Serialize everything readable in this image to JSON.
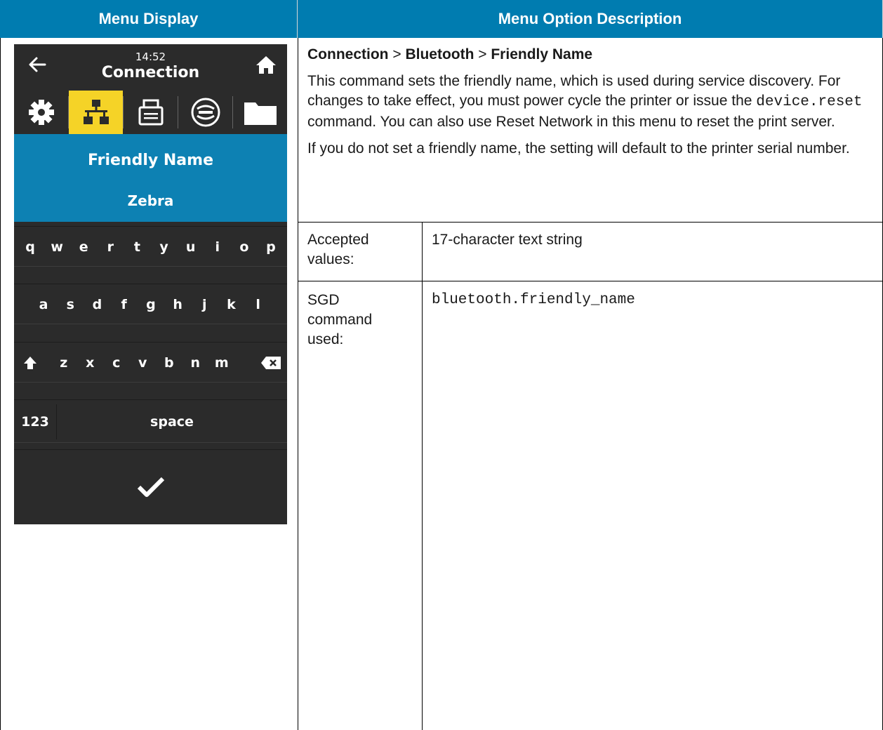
{
  "table": {
    "header_left": "Menu Display",
    "header_right": "Menu Option Description"
  },
  "device": {
    "time": "14:52",
    "title": "Connection",
    "tabs": [
      {
        "icon": "gear-icon",
        "active": false
      },
      {
        "icon": "network-icon",
        "active": true
      },
      {
        "icon": "printer-icon",
        "active": false
      },
      {
        "icon": "wireless-icon",
        "active": false
      },
      {
        "icon": "folder-icon",
        "active": false
      }
    ],
    "field_label": "Friendly Name",
    "field_value": "Zebra",
    "keyboard": {
      "row1": [
        "q",
        "w",
        "e",
        "r",
        "t",
        "y",
        "u",
        "i",
        "o",
        "p"
      ],
      "row2": [
        "a",
        "s",
        "d",
        "f",
        "g",
        "h",
        "j",
        "k",
        "l"
      ],
      "row3": [
        "z",
        "x",
        "c",
        "v",
        "b",
        "n",
        "m"
      ],
      "numbers_key": "123",
      "space_key": "space"
    },
    "colors": {
      "accent": "#f5d327",
      "panel": "#0d81b3",
      "bg": "#2b2b2b"
    }
  },
  "description": {
    "crumb_1": "Connection",
    "crumb_sep_1": " > ",
    "crumb_2": "Bluetooth",
    "crumb_sep_2": " > ",
    "crumb_3": "Friendly Name",
    "p1_a": "This command sets the friendly name, which is used during service discovery. For changes to take effect, you must power cycle the printer or issue the ",
    "p1_code": "device.reset",
    "p1_b": " command. You can also use Reset Network in this menu to reset the print server.",
    "p2": "If you do not set a friendly name, the setting will default to the printer serial number."
  },
  "rows": {
    "accepted_label": "Accepted values:",
    "accepted_value": "17-character text string",
    "sgd_label": "SGD command used:",
    "sgd_value": "bluetooth.friendly_name"
  }
}
